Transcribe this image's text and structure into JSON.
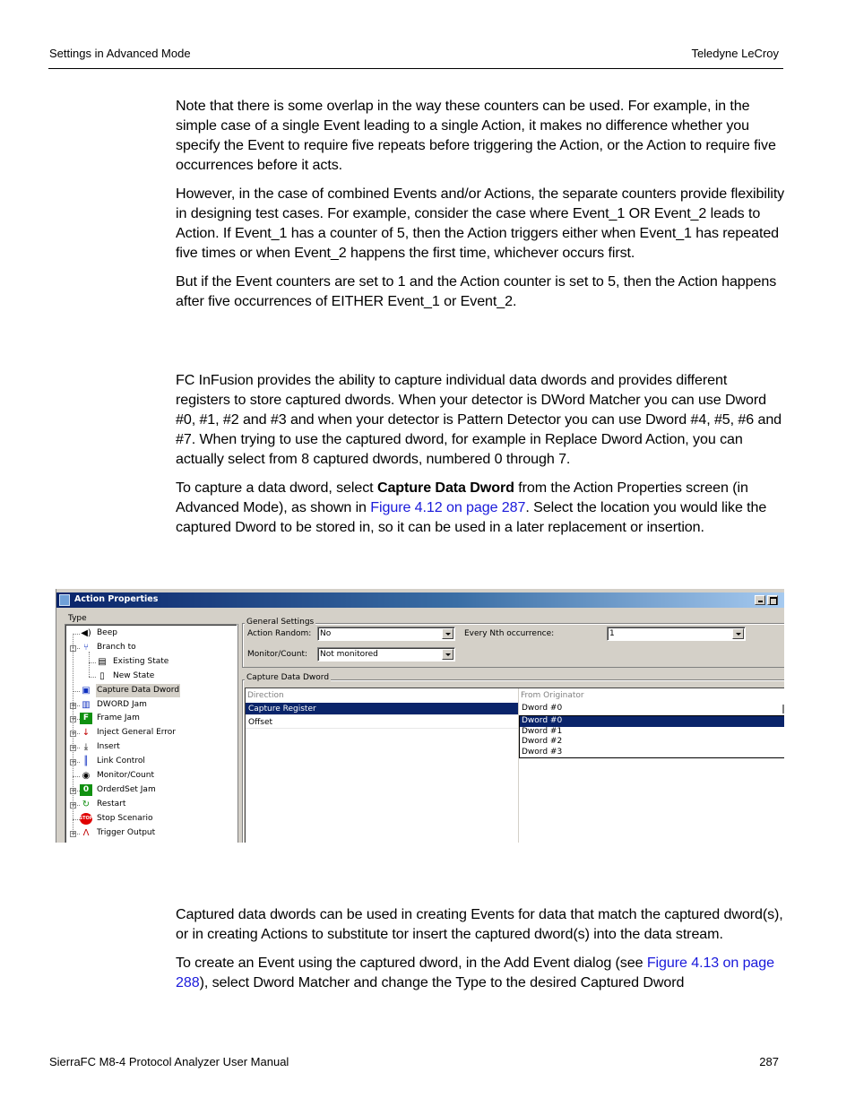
{
  "header": {
    "section": "Settings in Advanced Mode",
    "brand": "Teledyne LeCroy"
  },
  "footer": {
    "manual_title": "SierraFC M8-4 Protocol Analyzer User Manual",
    "page_number": "287"
  },
  "paragraphs_top": [
    "Note that there is some overlap in the way these counters can be used. For example, in the simple case of a single Event leading to a single Action, it makes no difference whether you specify the Event to require five repeats before triggering the Action, or the Action to require five occurrences before it acts.",
    "However, in the case of combined Events and/or Actions, the separate counters provide flexibility in designing test cases. For example, consider the case where Event_1 OR Event_2 leads to Action. If Event_1 has a counter of 5, then the Action triggers either when Event_1 has repeated five times or when Event_2 happens the first time, whichever occurs first.",
    "But if the Event counters are set to 1 and the Action counter is set to 5, then the Action happens after five occurrences of EITHER Event_1 or Event_2."
  ],
  "capture_section": {
    "intro": "FC InFusion provides the ability to capture individual data dwords and provides different registers to store captured dwords. When your detector is DWord Matcher you can use Dword #0, #1, #2 and #3 and when your detector is Pattern Detector you can use Dword #4, #5, #6 and #7. When trying to use the captured dword, for example in Replace Dword Action, you can actually select from 8 captured dwords, numbered 0 through 7.",
    "instr_part1": "To capture a data dword, select ",
    "instr_bold": "Capture Data Dword",
    "instr_part2": " from the Action Properties screen (in Advanced Mode), as shown in ",
    "instr_link": "Figure 4.12 on page 287",
    "instr_part3": ". Select the location you would like the captured Dword to be stored in, so it can be used in a later replacement or insertion."
  },
  "dialog": {
    "title": "Action Properties",
    "type_label": "Type",
    "tree_items": [
      {
        "label": "Beep",
        "icon": "speaker-icon",
        "level": 0,
        "expander": false
      },
      {
        "label": "Branch to",
        "icon": "branch-icon",
        "level": 0,
        "expander": "-"
      },
      {
        "label": "Existing State",
        "icon": "existing-state-icon",
        "level": 1,
        "expander": false
      },
      {
        "label": "New State",
        "icon": "new-state-icon",
        "level": 1,
        "expander": false
      },
      {
        "label": "Capture Data Dword",
        "icon": "capture-dword-icon",
        "level": 0,
        "expander": false,
        "selected": true
      },
      {
        "label": "DWORD Jam",
        "icon": "dword-jam-icon",
        "level": 0,
        "expander": "+"
      },
      {
        "label": "Frame Jam",
        "icon": "frame-jam-icon",
        "level": 0,
        "expander": "+"
      },
      {
        "label": "Inject General Error",
        "icon": "inject-error-icon",
        "level": 0,
        "expander": "+"
      },
      {
        "label": "Insert",
        "icon": "insert-icon",
        "level": 0,
        "expander": "+"
      },
      {
        "label": "Link Control",
        "icon": "link-control-icon",
        "level": 0,
        "expander": "+"
      },
      {
        "label": "Monitor/Count",
        "icon": "monitor-count-icon",
        "level": 0,
        "expander": false
      },
      {
        "label": "OrderdSet Jam",
        "icon": "orderedset-jam-icon",
        "level": 0,
        "expander": "+"
      },
      {
        "label": "Restart",
        "icon": "restart-icon",
        "level": 0,
        "expander": "+"
      },
      {
        "label": "Stop Scenario",
        "icon": "stop-icon",
        "level": 0,
        "expander": false
      },
      {
        "label": "Trigger Output",
        "icon": "trigger-output-icon",
        "level": 0,
        "expander": "+"
      }
    ],
    "general_settings": {
      "group_label": "General Settings",
      "action_random_label": "Action Random:",
      "action_random_value": "No",
      "every_nth_label": "Every Nth occurrence:",
      "every_nth_value": "1",
      "monitor_count_label": "Monitor/Count:",
      "monitor_count_value": "Not monitored"
    },
    "capture_group": {
      "group_label": "Capture Data Dword",
      "col_direction": "Direction",
      "col_originator": "From Originator",
      "rows": [
        "Capture Register",
        "Offset"
      ],
      "current_value": "Dword #0",
      "dropdown_options": [
        "Dword #0",
        "Dword #1",
        "Dword #2",
        "Dword #3"
      ],
      "dropdown_selected": "Dword #0"
    }
  },
  "usage_section": {
    "para1": "Captured data dwords can be used in creating Events for data that match the captured dword(s), or in creating Actions to substitute tor insert the captured dword(s) into the data stream.",
    "para2_part1": "To create an Event using the captured dword, in the Add Event dialog (see ",
    "para2_link": "Figure 4.13 on page 288",
    "para2_part2": "), select Dword Matcher and change the Type to the desired Captured Dword"
  }
}
